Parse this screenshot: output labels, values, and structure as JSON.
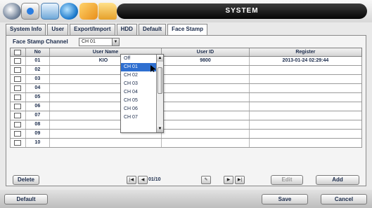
{
  "title": "SYSTEM",
  "tabs": [
    {
      "label": "System Info",
      "active": false
    },
    {
      "label": "User",
      "active": false
    },
    {
      "label": "Export/Import",
      "active": false
    },
    {
      "label": "HDD",
      "active": false
    },
    {
      "label": "Default",
      "active": false
    },
    {
      "label": "Face Stamp",
      "active": true
    }
  ],
  "face_stamp": {
    "channel_label": "Face Stamp Channel",
    "channel_value": "CH 01",
    "dropdown_options": [
      "Off",
      "CH 01",
      "CH 02",
      "CH 03",
      "CH 04",
      "CH 05",
      "CH 06",
      "CH 07"
    ],
    "dropdown_selected": "CH 01"
  },
  "table": {
    "headers": [
      "",
      "No",
      "User Name",
      "User ID",
      "Register"
    ],
    "rows": [
      {
        "no": "01",
        "name": "KIO",
        "id": "9800",
        "register": "2013-01-24 02:29:44"
      },
      {
        "no": "02",
        "name": "",
        "id": "",
        "register": ""
      },
      {
        "no": "03",
        "name": "",
        "id": "",
        "register": ""
      },
      {
        "no": "04",
        "name": "",
        "id": "",
        "register": ""
      },
      {
        "no": "05",
        "name": "",
        "id": "",
        "register": ""
      },
      {
        "no": "06",
        "name": "",
        "id": "",
        "register": ""
      },
      {
        "no": "07",
        "name": "",
        "id": "",
        "register": ""
      },
      {
        "no": "08",
        "name": "",
        "id": "",
        "register": ""
      },
      {
        "no": "09",
        "name": "",
        "id": "",
        "register": ""
      },
      {
        "no": "10",
        "name": "",
        "id": "",
        "register": ""
      }
    ]
  },
  "controls": {
    "delete_label": "Delete",
    "page_indicator": "01/10",
    "edit_label": "Edit",
    "add_label": "Add"
  },
  "footer": {
    "default_label": "Default",
    "save_label": "Save",
    "cancel_label": "Cancel"
  },
  "colors": {
    "title_bar": "#050505",
    "selection": "#2f6fd0",
    "text": "#1a2a4a"
  }
}
